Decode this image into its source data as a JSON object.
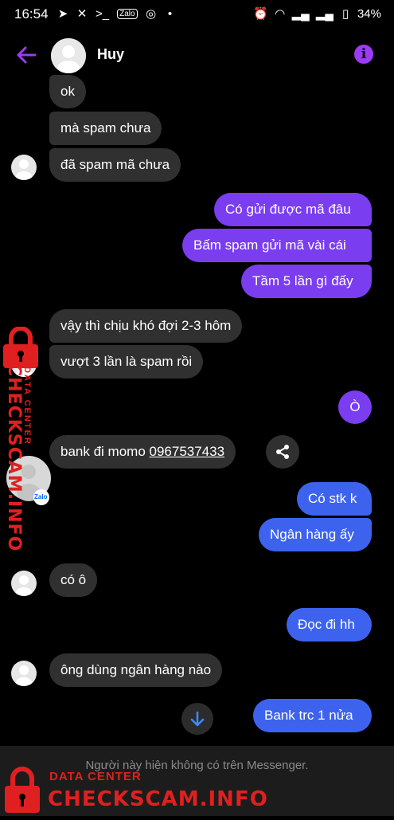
{
  "status_bar": {
    "time": "16:54",
    "icons_left": [
      "telegram-icon",
      "bolt-icon",
      "terminal-icon",
      "zalo-icon",
      "messenger-icon",
      "dot-icon"
    ],
    "battery": "34%"
  },
  "header": {
    "name": "Huy"
  },
  "messages": [
    {
      "dir": "in",
      "text": "ok"
    },
    {
      "dir": "in",
      "text": "mà spam chưa"
    },
    {
      "dir": "in",
      "text": "đã spam mã chưa"
    },
    {
      "dir": "out",
      "text": "Có gửi được mã đâu"
    },
    {
      "dir": "out",
      "text": "Bấm spam gửi mã vài cái"
    },
    {
      "dir": "out",
      "text": "Tầm 5 lần gì đấy"
    },
    {
      "dir": "in",
      "text": "vậy thì chịu khó đợi 2-3 hôm"
    },
    {
      "dir": "in",
      "text": "vượt 3 lần là spam rồi"
    },
    {
      "dir": "out",
      "text": "Ò"
    },
    {
      "dir": "in",
      "text": "bank đi momo ",
      "link": "0967537433"
    },
    {
      "dir": "out",
      "text": "Có stk k"
    },
    {
      "dir": "out",
      "text": "Ngân hàng ấy"
    },
    {
      "dir": "in",
      "text": "có ô"
    },
    {
      "dir": "out",
      "text": "Đọc đi hh"
    },
    {
      "dir": "in",
      "text": "ông dùng ngân hàng nào"
    },
    {
      "dir": "out",
      "text": "Bank trc 1 nửa"
    }
  ],
  "footer": {
    "note": "Người này hiện không có trên Messenger."
  },
  "watermark": {
    "side_text": "CHECKSCAM.INFO",
    "side_small": "DATA CENTER",
    "small_text": "DATA CENTER",
    "brand_text": "CHECKSCAM.INFO",
    "badge": "Zalo"
  },
  "colors": {
    "accent": "#9b3cf0",
    "outgoing_purple": "#7a3df0",
    "outgoing_blue": "#3d63ee",
    "incoming": "#303030",
    "watermark": "#e02020"
  }
}
